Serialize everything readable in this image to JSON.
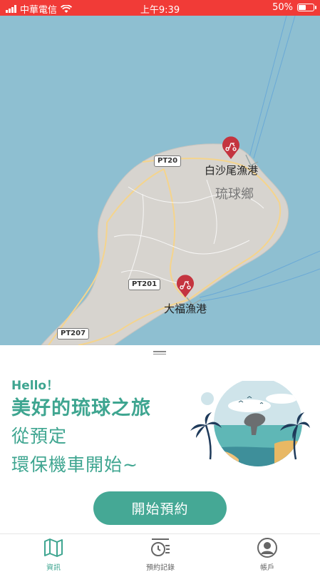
{
  "status_bar": {
    "carrier": "中華電信",
    "time": "上午9:39",
    "battery": "50%",
    "battery_level": 0.5
  },
  "map": {
    "region_label": "琉球鄉",
    "ports": [
      {
        "name": "白沙尾漁港"
      },
      {
        "name": "大福漁港"
      }
    ],
    "roads": [
      "PT20",
      "PT201",
      "PT207"
    ],
    "colors": {
      "sea": "#8ebfd1",
      "land": "#d7d4cf",
      "road": "#f5d48c",
      "pin": "#c4343f"
    }
  },
  "sheet": {
    "hello": "Hello！",
    "headline": "美好的琉球之旅",
    "line1": "從預定",
    "line2": "環保機車開始~",
    "start_button": "開始預約"
  },
  "tabs": [
    {
      "label": "資訊",
      "icon": "map-icon",
      "active": true
    },
    {
      "label": "預約記錄",
      "icon": "clock-list-icon",
      "active": false
    },
    {
      "label": "帳戶",
      "icon": "account-icon",
      "active": false
    }
  ],
  "colors": {
    "accent": "#3ea590",
    "status_bar": "#f13b37",
    "inactive_tab": "#666666"
  }
}
